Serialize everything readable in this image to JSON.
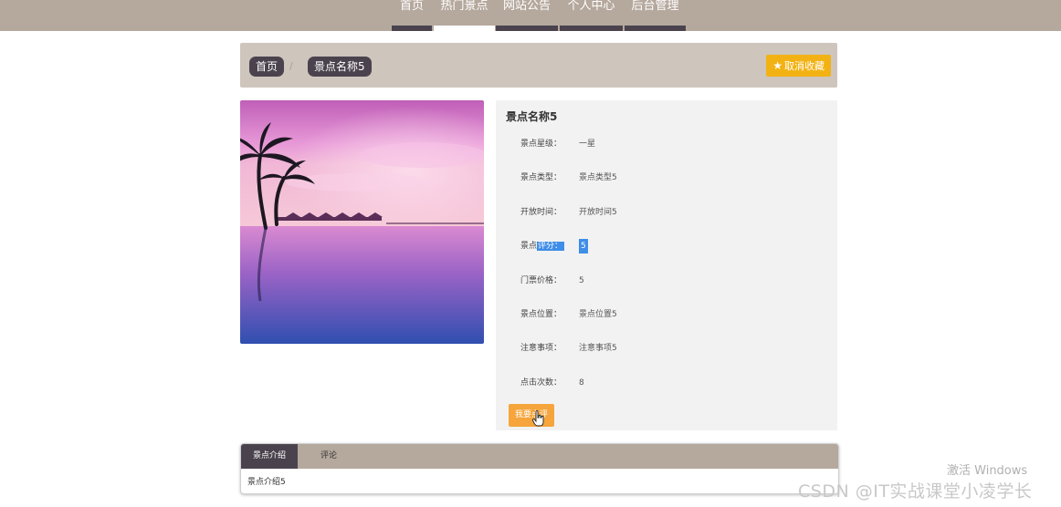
{
  "nav": {
    "items": [
      {
        "label": "首页"
      },
      {
        "label": "热门景点"
      },
      {
        "label": "网站公告"
      },
      {
        "label": "个人中心"
      },
      {
        "label": "后台管理"
      }
    ],
    "active_index": 1
  },
  "breadcrumb": {
    "home": "首页",
    "separator": "/",
    "current": "景点名称5"
  },
  "favorite_button": {
    "label": "取消收藏",
    "icon": "star-icon"
  },
  "detail": {
    "title": "景点名称5",
    "fields": [
      {
        "key": "景点星级：",
        "value": "一星"
      },
      {
        "key": "景点类型：",
        "value": "景点类型5"
      },
      {
        "key": "开放时间：",
        "value": "开放时间5"
      },
      {
        "key_prefix": "景点",
        "key_selected": "评分：",
        "value": "5"
      },
      {
        "key": "门票价格：",
        "value": "5"
      },
      {
        "key": "景点位置：",
        "value": "景点位置5"
      },
      {
        "key": "注意事项：",
        "value": "注意事项5"
      },
      {
        "key": "点击次数：",
        "value": "8"
      }
    ],
    "comment_button": "我要点评"
  },
  "tabs": {
    "items": [
      {
        "label": "景点介绍"
      },
      {
        "label": "评论"
      }
    ],
    "active_index": 0,
    "content": "景点介绍5"
  },
  "watermarks": {
    "windows": "激活 Windows",
    "csdn": "CSDN @IT实战课堂小凌学长"
  },
  "colors": {
    "nav_bg": "#b5a89d",
    "dark": "#4a434e",
    "accent_yellow": "#f3b214",
    "accent_orange": "#f5a53b",
    "selection": "#3f8ee8"
  }
}
